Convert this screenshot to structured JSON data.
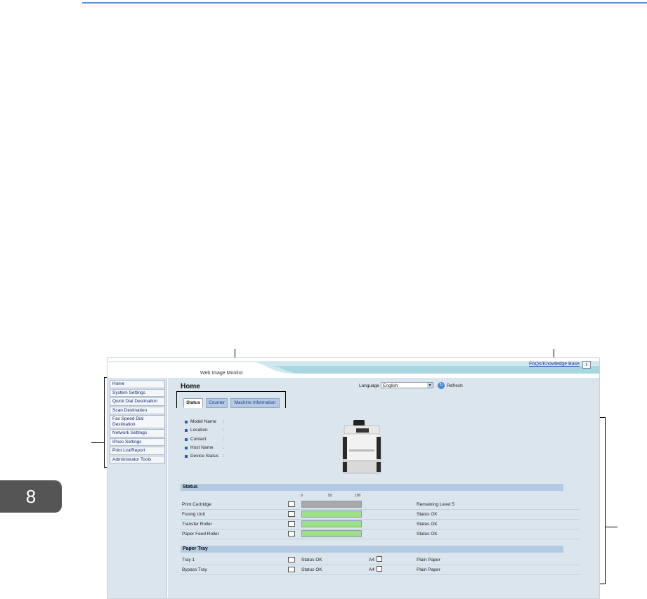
{
  "chapter": "8",
  "header": {
    "app_title": "Web Image Monitor",
    "faq_link": "FAQs/Knowledge Base",
    "info_icon": "i"
  },
  "sidebar": {
    "items": [
      {
        "label": "Home"
      },
      {
        "label": "System Settings"
      },
      {
        "label": "Quick Dial Destination"
      },
      {
        "label": "Scan Destination"
      },
      {
        "label": "Fax Speed Dial Destination"
      },
      {
        "label": "Network Settings"
      },
      {
        "label": "IPsec Settings"
      },
      {
        "label": "Print List/Report"
      },
      {
        "label": "Administrator Tools"
      }
    ]
  },
  "main": {
    "title": "Home",
    "language_label": "Language",
    "language_value": "English",
    "refresh_label": "Refresh",
    "tabs": [
      {
        "label": "Status"
      },
      {
        "label": "Counter"
      },
      {
        "label": "Machine Information"
      }
    ],
    "info_fields": [
      {
        "label": "Model Name",
        "sep": ":"
      },
      {
        "label": "Location",
        "sep": ":"
      },
      {
        "label": "Contact",
        "sep": ":"
      },
      {
        "label": "Host Name",
        "sep": ":"
      },
      {
        "label": "Device Status",
        "sep": ":"
      }
    ],
    "status_section": {
      "title": "Status",
      "scale": [
        "0",
        "50",
        "100"
      ],
      "rows": [
        {
          "name": "Print Cartridge",
          "status": "Remaining Level 5",
          "level": 1.0,
          "color": "#a9a9a9"
        },
        {
          "name": "Fusing Unit",
          "status": "Status OK",
          "level": 1.0,
          "color": "#9ee08a"
        },
        {
          "name": "Transfer Roller",
          "status": "Status OK",
          "level": 1.0,
          "color": "#9ee08a"
        },
        {
          "name": "Paper Feed Roller",
          "status": "Status OK",
          "level": 1.0,
          "color": "#9ee08a"
        }
      ]
    },
    "paper_tray_section": {
      "title": "Paper Tray",
      "rows": [
        {
          "name": "Tray 1",
          "status": "Status OK",
          "size": "A4",
          "type": "Plain Paper"
        },
        {
          "name": "Bypass Tray",
          "status": "Status OK",
          "size": "A4",
          "type": "Plain Paper"
        }
      ]
    }
  },
  "colors": {
    "panel_bg": "#dbe5ee",
    "section_header": "#b4c9e2",
    "link": "#1a3c8c",
    "accent": "#5b8fc9"
  }
}
